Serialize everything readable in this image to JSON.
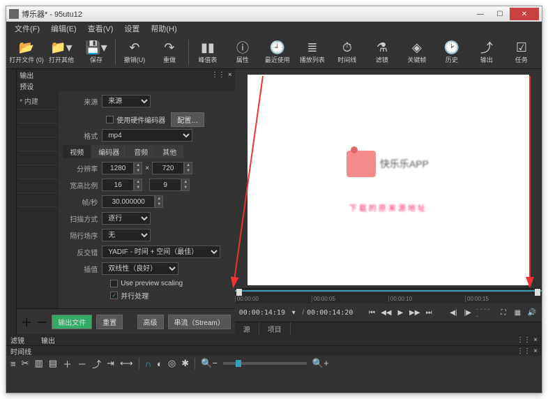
{
  "window": {
    "title": "博乐器* - 95utu12"
  },
  "menu": {
    "file": "文件(F)",
    "edit": "编辑(E)",
    "view": "查看(V)",
    "settings": "设置",
    "help": "帮助(H)"
  },
  "toolbar": {
    "open_file": "打开文件 (0)",
    "open_other": "打开其他",
    "save": "保存",
    "undo": "撤销(U)",
    "redo": "重做",
    "peak": "峰值表",
    "props": "属性",
    "recent": "最近使用",
    "playlist": "播放列表",
    "timeline": "时间线",
    "filters": "滤镜",
    "keyframes": "关键帧",
    "history": "历史",
    "export": "输出",
    "jobs": "任务"
  },
  "export_panel": {
    "header": "输出",
    "preset": "预设",
    "builtin_label": "* 内建",
    "source_label": "来源",
    "source_value": "来源",
    "hw_encoder": "使用硬件编码器",
    "configure": "配置…",
    "format_label": "格式",
    "format_value": "mp4",
    "tabs": {
      "video": "视频",
      "encoder": "编码器",
      "audio": "音频",
      "other": "其他"
    },
    "resolution_label": "分辨率",
    "res_w": "1280",
    "res_h": "720",
    "x": "×",
    "aspect_label": "宽高比例",
    "aspect_w": "16",
    "aspect_h": "9",
    "fps_label": "帧/秒",
    "fps_value": "30.000000",
    "scan_label": "扫描方式",
    "scan_value": "逐行",
    "field_label": "隔行场序",
    "field_value": "无",
    "deint_label": "反交错",
    "deint_value": "YADIF - 时间 + 空间（最佳）",
    "interp_label": "插值",
    "interp_value": "双线性（良好）",
    "preview_scale": "Use preview scaling",
    "parallel": "并行处理",
    "export_file": "输出文件",
    "reset": "重置",
    "advanced": "高级",
    "stream": "串流（Stream）"
  },
  "filters": {
    "header_left": "滤镜",
    "header_right": "输出"
  },
  "preview": {
    "logo_text": "快乐乐APP",
    "subtitle": "下载的原来源地址"
  },
  "ruler": {
    "t0": "00:00:00",
    "t1": "00:00:05",
    "t2": "00:00:10",
    "t3": "00:00:15"
  },
  "transport": {
    "tc_left": "00:00:14:19",
    "tc_right": "00:00:14:20",
    "dashes": "- - - - -"
  },
  "bottom_tabs": {
    "source": "源",
    "project": "项目"
  },
  "timeline": {
    "header": "时间线"
  }
}
